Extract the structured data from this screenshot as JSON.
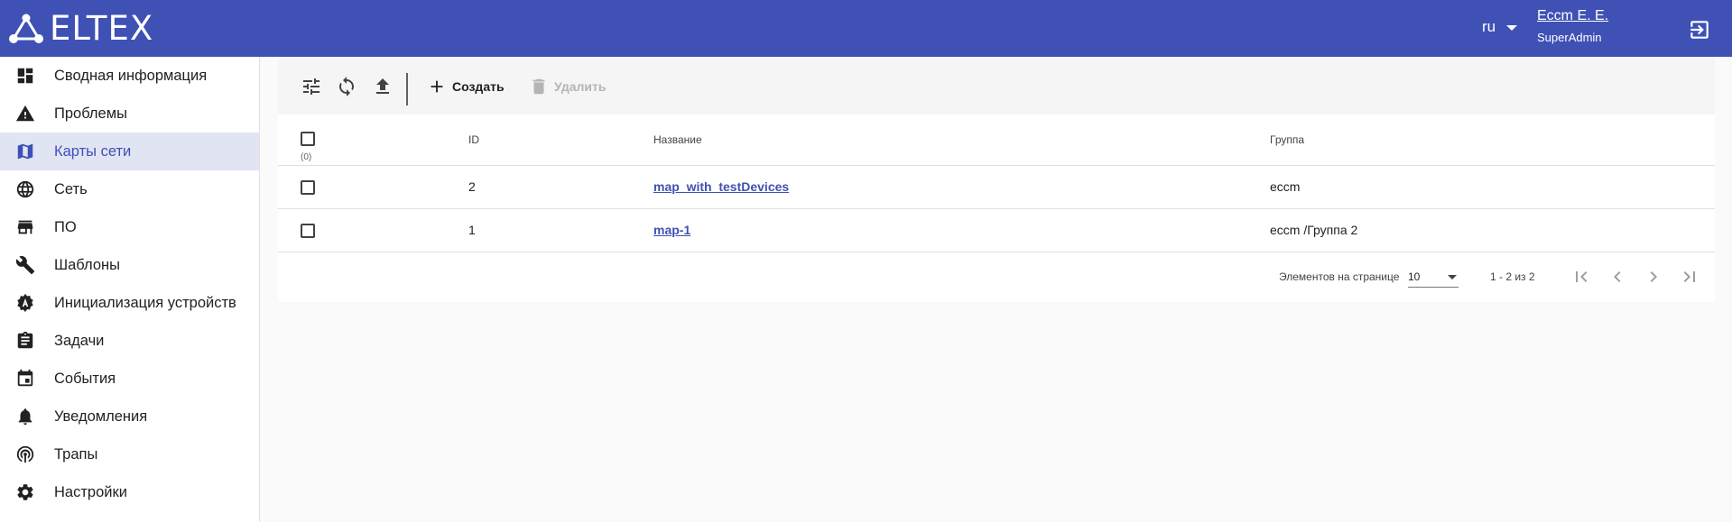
{
  "header": {
    "logo_text": "ELTEX",
    "language": "ru",
    "user_name": "Eccm E. E.",
    "user_role": "SuperAdmin"
  },
  "colors": {
    "header_bg": "#3f51b5",
    "active_nav_bg": "#e1e4f3",
    "accent": "#3f51b5"
  },
  "sidebar": {
    "items": [
      {
        "label": "Сводная информация",
        "icon": "dashboard-icon"
      },
      {
        "label": "Проблемы",
        "icon": "warning-icon"
      },
      {
        "label": "Карты сети",
        "icon": "map-icon",
        "active": true
      },
      {
        "label": "Сеть",
        "icon": "globe-icon"
      },
      {
        "label": "ПО",
        "icon": "store-icon"
      },
      {
        "label": "Шаблоны",
        "icon": "wrench-icon"
      },
      {
        "label": "Инициализация устройств",
        "icon": "gear-a-icon"
      },
      {
        "label": "Задачи",
        "icon": "clipboard-icon"
      },
      {
        "label": "События",
        "icon": "calendar-icon"
      },
      {
        "label": "Уведомления",
        "icon": "bell-icon"
      },
      {
        "label": "Трапы",
        "icon": "signal-icon"
      },
      {
        "label": "Настройки",
        "icon": "gear-icon"
      }
    ]
  },
  "toolbar": {
    "create_label": "Создать",
    "delete_label": "Удалить"
  },
  "table": {
    "selected_count": "(0)",
    "columns": {
      "id": "ID",
      "name": "Название",
      "group": "Группа"
    },
    "rows": [
      {
        "id": "2",
        "name": "map_with_testDevices",
        "group": "eccm"
      },
      {
        "id": "1",
        "name": "map-1",
        "group": "eccm /Группа 2"
      }
    ]
  },
  "pager": {
    "items_per_page_label": "Элементов на странице",
    "items_per_page": "10",
    "range": "1 - 2 из 2"
  }
}
